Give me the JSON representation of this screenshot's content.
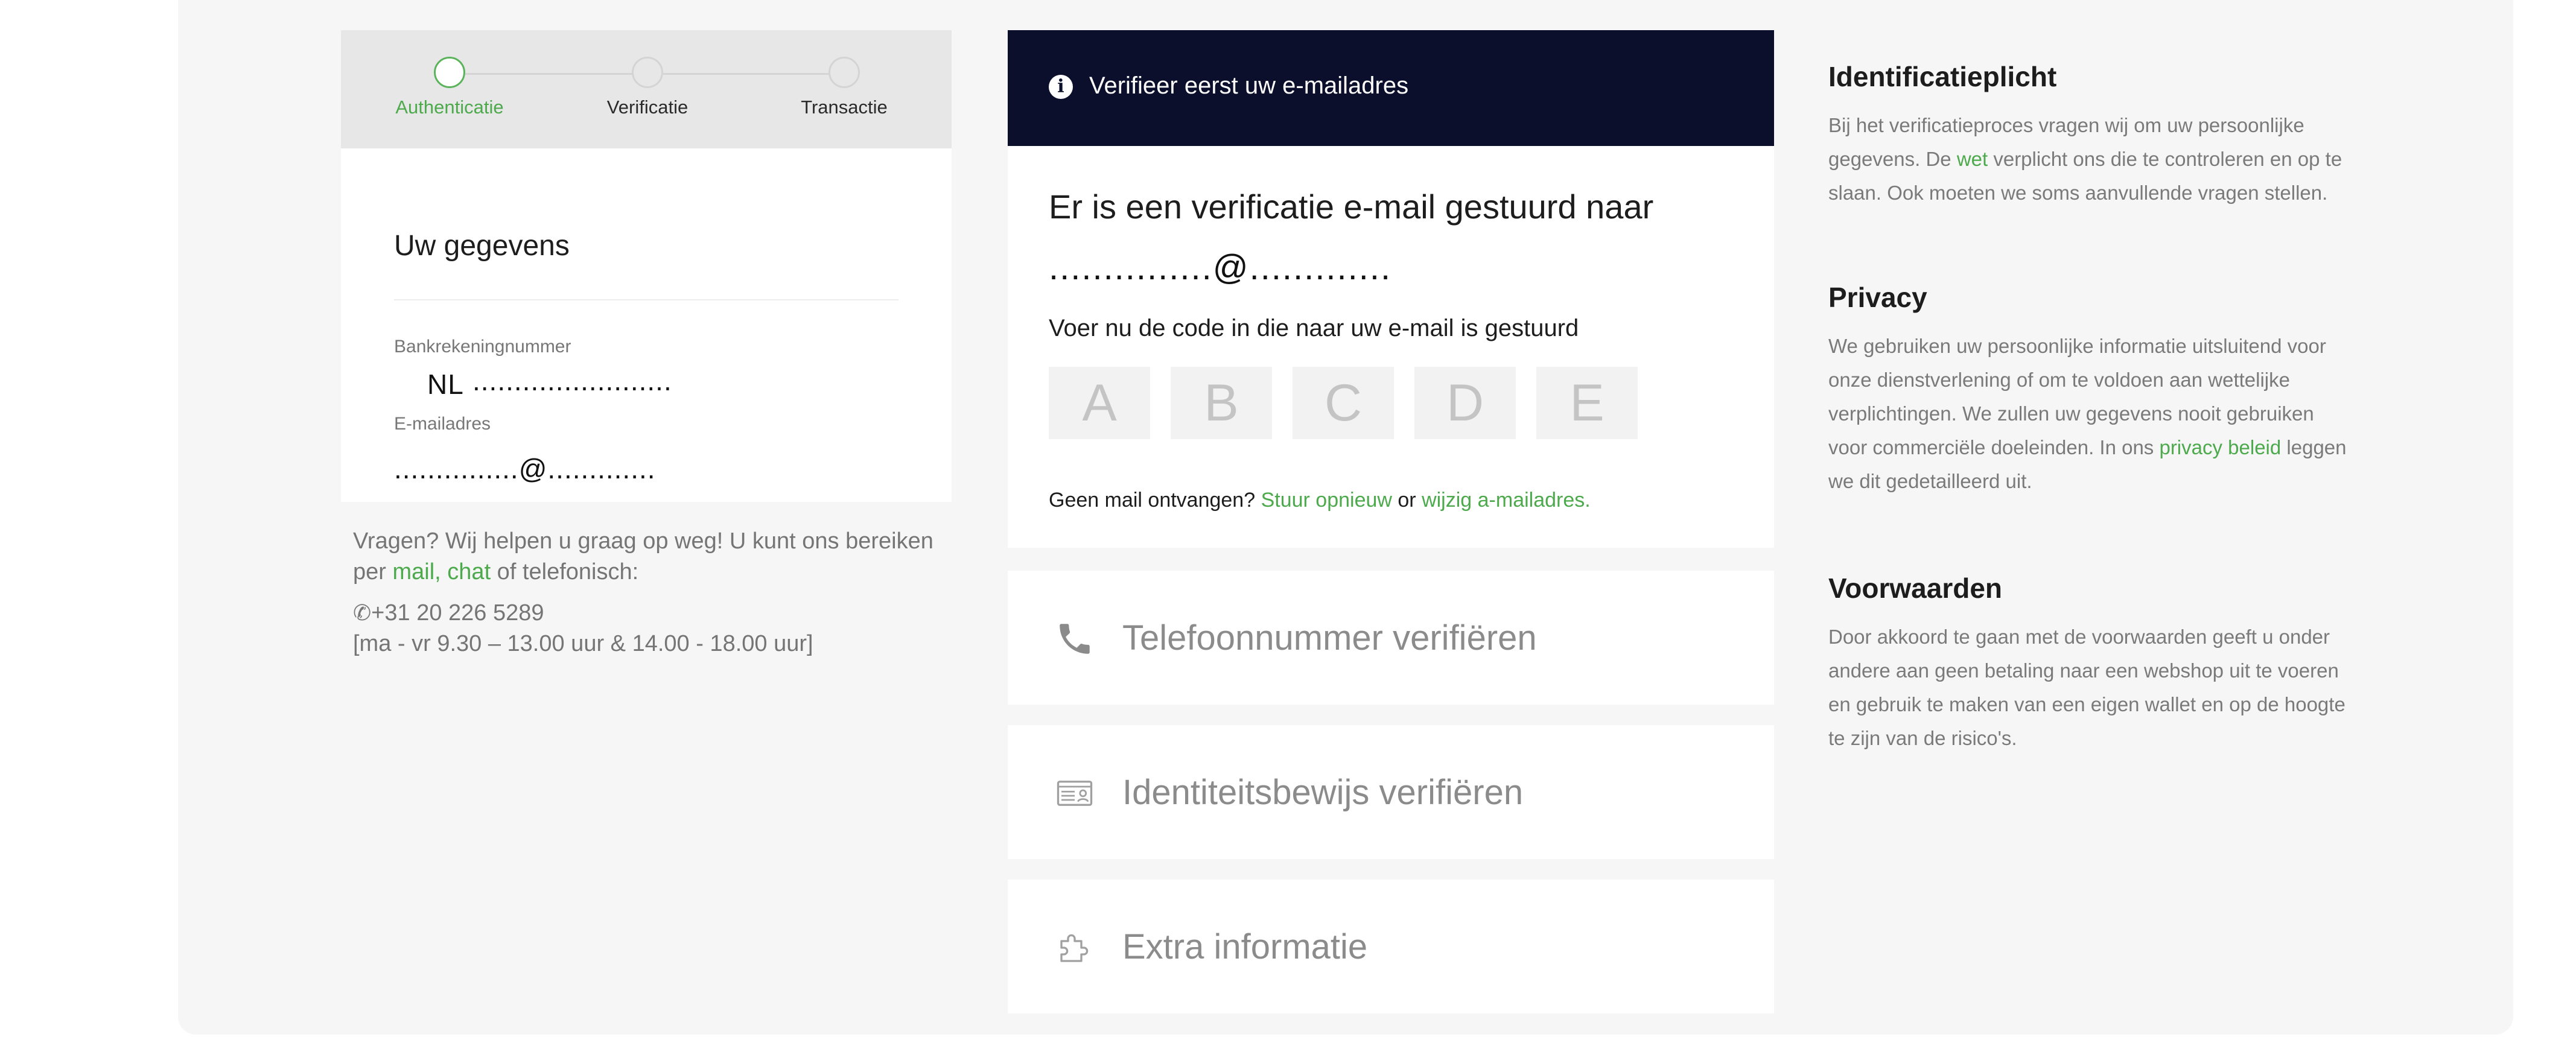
{
  "stepper": {
    "steps": [
      {
        "label": "Authenticatie",
        "active": true
      },
      {
        "label": "Verificatie",
        "active": false
      },
      {
        "label": "Transactie",
        "active": false
      }
    ]
  },
  "details": {
    "title": "Uw gegevens",
    "bank_label": "Bankrekeningnummer",
    "bank_prefix": "NL",
    "bank_value": "........................",
    "email_label": "E-mailadres",
    "email_value": "...............@............."
  },
  "help": {
    "text_before": "Vragen? Wij helpen u graag op weg! U kunt ons bereiken per ",
    "mail_link": "mail",
    "comma": ", ",
    "chat_link": "chat",
    "text_after": " of telefonisch:",
    "phone": "+31 20 226 5289",
    "hours": "[ma - vr 9.30 – 13.00 uur & 14.00 - 18.00 uur]"
  },
  "verify": {
    "header": "Verifieer eerst uw e-mailadres",
    "sent_text": "Er is een verificatie e-mail gestuurd naar",
    "sent_email": "...............@.............",
    "code_prompt": "Voer nu de code in die naar uw e-mail is gestuurd",
    "code_placeholders": [
      "A",
      "B",
      "C",
      "D",
      "E"
    ],
    "no_mail": "Geen mail ontvangen? ",
    "resend_link": "Stuur opnieuw",
    "or": " or ",
    "change_link": "wijzig a-mailadres."
  },
  "accordion": [
    {
      "label": "Telefoonnummer verifiëren",
      "icon": "phone-icon"
    },
    {
      "label": "Identiteitsbewijs verifiëren",
      "icon": "id-card-icon"
    },
    {
      "label": "Extra informatie",
      "icon": "puzzle-icon"
    }
  ],
  "sidebar": {
    "id_title": "Identificatieplicht",
    "id_before": "Bij het verificatieproces vragen wij om uw persoonlijke gegevens. De ",
    "id_link": "wet",
    "id_after": " verplicht ons die te controleren en op te slaan. Ook moeten we soms aanvullende vragen stellen.",
    "privacy_title": "Privacy",
    "privacy_before": "We gebruiken uw persoonlijke informatie uitsluitend voor onze dienstverlening of om te voldoen aan wettelijke verplichtingen. We zullen uw gegevens nooit gebruiken voor commerciële doeleinden. In ons ",
    "privacy_link": "privacy beleid",
    "privacy_after": " leggen we dit gedetailleerd uit.",
    "terms_title": "Voorwaarden",
    "terms_body": "Door akkoord te gaan met de voorwaarden geeft u onder andere aan geen betaling naar een webshop uit te voeren en gebruik te maken van een eigen wallet en op de hoogte te zijn van de risico's."
  },
  "colors": {
    "accent_green": "#4caa4c",
    "header_navy": "#0b0f2b"
  }
}
